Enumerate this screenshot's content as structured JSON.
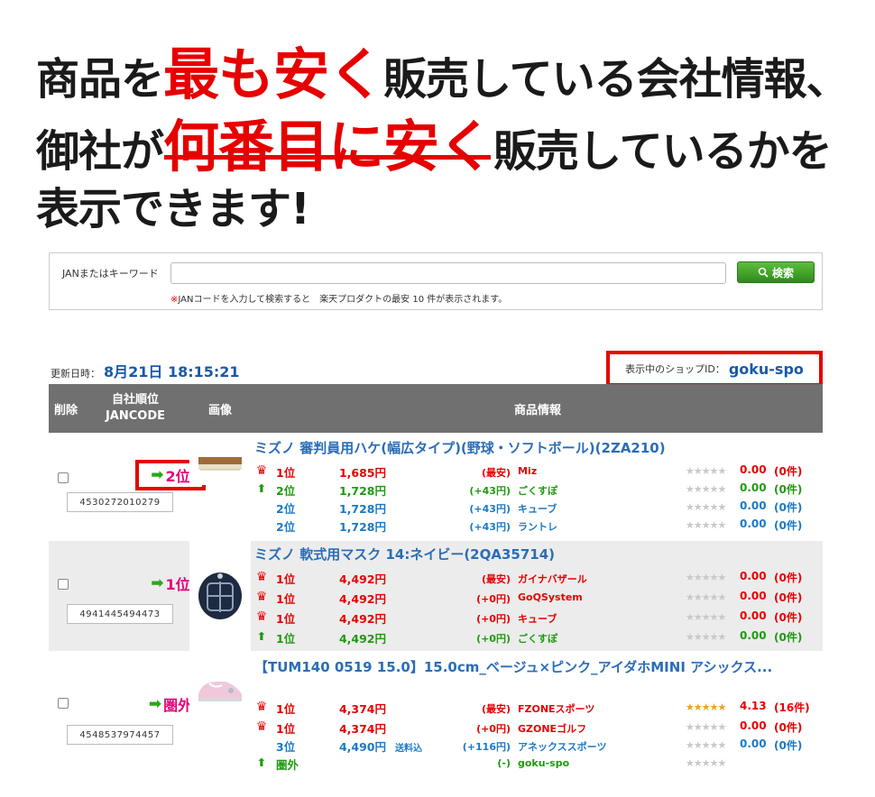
{
  "headline": {
    "line1_pre": "商品を",
    "line1_red": "最も安く",
    "line1_post": "販売している会社情報、",
    "line2_pre": "御社が",
    "line2_red": "何番目に安く",
    "line2_post": "販売しているかを",
    "line3": "表示できます!"
  },
  "search": {
    "label": "JANまたはキーワード",
    "value": "",
    "placeholder": "",
    "button_label": "検索",
    "note_mark": "※",
    "note": "JANコードを入力して検索すると　楽天プロダクトの最安 10 件が表示されます。"
  },
  "updated": {
    "label": "更新日時：",
    "value": "8月21日 18:15:21"
  },
  "shop": {
    "label": "表示中のショップID：",
    "value": "goku-spo"
  },
  "table": {
    "headers": {
      "delete": "削除",
      "rank_line1": "自社順位",
      "rank_line2": "JANCODE",
      "image": "画像",
      "info": "商品情報"
    }
  },
  "products": [
    {
      "rank": "2位",
      "jan": "4530272010279",
      "title": "ミズノ 審判員用ハケ(幅広タイプ)(野球・ソフトボール)(2ZA210)",
      "lines": [
        {
          "icon": "crown",
          "rank": "1位",
          "price": "1,685円",
          "ship": "",
          "diff": "(最安)",
          "shop": "Miz",
          "stars": "★★★★★",
          "score": "0.00",
          "count": "(0件)",
          "color": "red"
        },
        {
          "icon": "up",
          "rank": "2位",
          "price": "1,728円",
          "ship": "",
          "diff": "(+43円)",
          "shop": "ごくすぽ",
          "stars": "★★★★★",
          "score": "0.00",
          "count": "(0件)",
          "color": "green"
        },
        {
          "icon": "",
          "rank": "2位",
          "price": "1,728円",
          "ship": "",
          "diff": "(+43円)",
          "shop": "キューブ",
          "stars": "★★★★★",
          "score": "0.00",
          "count": "(0件)",
          "color": "blue"
        },
        {
          "icon": "",
          "rank": "2位",
          "price": "1,728円",
          "ship": "",
          "diff": "(+43円)",
          "shop": "ラントレ",
          "stars": "★★★★★",
          "score": "0.00",
          "count": "(0件)",
          "color": "blue"
        }
      ]
    },
    {
      "rank": "1位",
      "jan": "4941445494473",
      "title": "ミズノ 軟式用マスク 14:ネイビー(2QA35714)",
      "lines": [
        {
          "icon": "crown",
          "rank": "1位",
          "price": "4,492円",
          "ship": "",
          "diff": "(最安)",
          "shop": "ガイナバザール",
          "stars": "★★★★★",
          "score": "0.00",
          "count": "(0件)",
          "color": "red"
        },
        {
          "icon": "crown",
          "rank": "1位",
          "price": "4,492円",
          "ship": "",
          "diff": "(+0円)",
          "shop": "GoQSystem",
          "stars": "★★★★★",
          "score": "0.00",
          "count": "(0件)",
          "color": "red"
        },
        {
          "icon": "crown",
          "rank": "1位",
          "price": "4,492円",
          "ship": "",
          "diff": "(+0円)",
          "shop": "キューブ",
          "stars": "★★★★★",
          "score": "0.00",
          "count": "(0件)",
          "color": "red"
        },
        {
          "icon": "up",
          "rank": "1位",
          "price": "4,492円",
          "ship": "",
          "diff": "(+0円)",
          "shop": "ごくすぽ",
          "stars": "★★★★★",
          "score": "0.00",
          "count": "(0件)",
          "color": "green"
        }
      ]
    },
    {
      "rank": "圏外",
      "jan": "4548537974457",
      "title": "【TUM140 0519 15.0】15.0cm_ベージュ×ピンク_アイダホMINI アシックス...",
      "lines": [
        {
          "icon": "crown",
          "rank": "1位",
          "price": "4,374円",
          "ship": "",
          "diff": "(最安)",
          "shop": "FZONEスポーツ",
          "stars": "★★★★★",
          "score": "4.13",
          "count": "(16件)",
          "color": "red",
          "gold": true
        },
        {
          "icon": "crown",
          "rank": "1位",
          "price": "4,374円",
          "ship": "",
          "diff": "(+0円)",
          "shop": "GZONEゴルフ",
          "stars": "★★★★★",
          "score": "0.00",
          "count": "(0件)",
          "color": "red"
        },
        {
          "icon": "",
          "rank": "3位",
          "price": "4,490円",
          "ship": "送料込",
          "diff": "(+116円)",
          "shop": "アネックススポーツ",
          "stars": "★★★★★",
          "score": "0.00",
          "count": "(0件)",
          "color": "blue"
        },
        {
          "icon": "up",
          "rank": "圏外",
          "price": "",
          "ship": "",
          "diff": "(-)",
          "shop": "goku-spo",
          "stars": "★★★★★",
          "score": "",
          "count": "",
          "color": "green"
        }
      ]
    }
  ]
}
